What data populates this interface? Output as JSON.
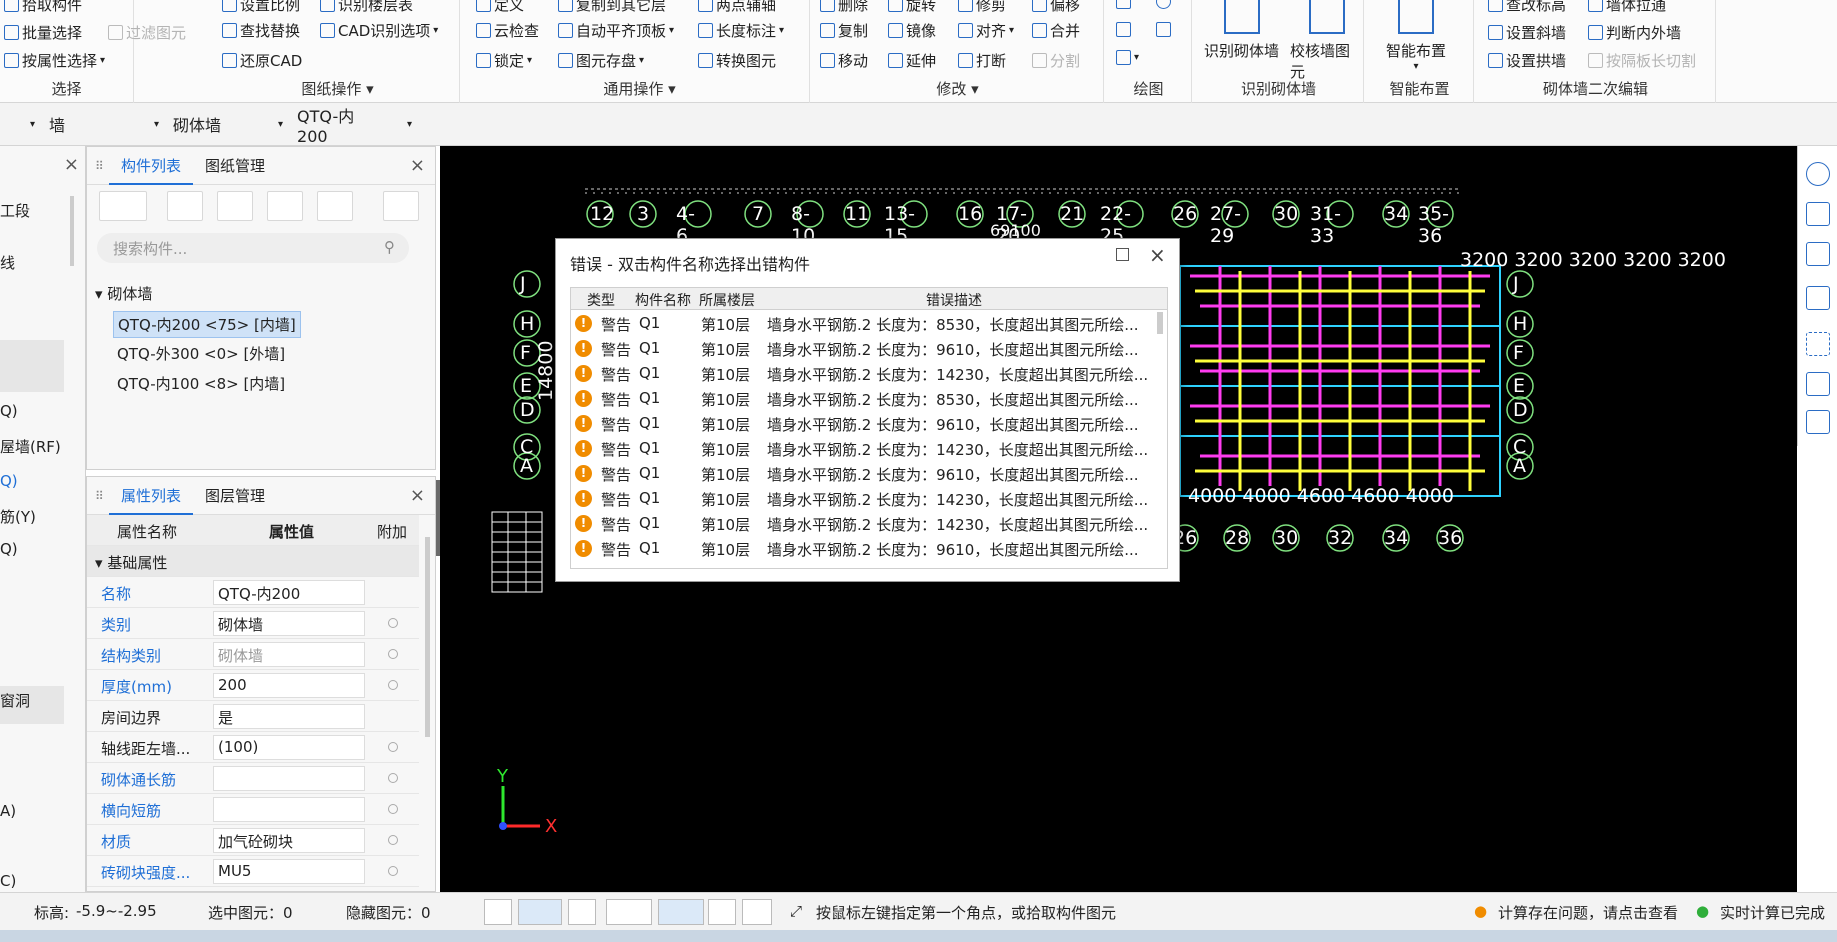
{
  "ribbon": {
    "select_group": {
      "items": [
        "拾取构件",
        "批量选择",
        "过滤图元",
        "按属性选择"
      ],
      "label": "选择"
    },
    "drawing_group": {
      "items": [
        "设置比例",
        "识别楼层表",
        "查找替换",
        "CAD识别选项",
        "还原CAD"
      ],
      "label": "图纸操作"
    },
    "general_group": {
      "items": [
        "定义",
        "复制到其它层",
        "两点辅轴",
        "云检查",
        "自动平齐顶板",
        "长度标注",
        "锁定",
        "图元存盘",
        "转换图元"
      ],
      "label": "通用操作"
    },
    "modify_group": {
      "items": [
        "删除",
        "旋转",
        "修剪",
        "偏移",
        "复制",
        "镜像",
        "对齐",
        "合并",
        "移动",
        "延伸",
        "打断",
        "分割"
      ],
      "label": "修改"
    },
    "draw_group": {
      "label": "绘图"
    },
    "recognize_group": {
      "items": [
        "识别砌体墙",
        "校核墙图元"
      ],
      "label": "识别砌体墙"
    },
    "smart_group": {
      "items": [
        "智能布置"
      ],
      "label": "智能布置"
    },
    "secondary_group": {
      "items": [
        "查改标高",
        "墙体拉通",
        "设置斜墙",
        "判断内外墙",
        "设置拱墙",
        "按隔板长切割"
      ],
      "label": "砌体墙二次编辑"
    }
  },
  "filter": {
    "floor": "墙",
    "type": "砌体墙",
    "component": "QTQ-内200"
  },
  "left_nav": {
    "items": [
      "工段",
      "线",
      "Q)",
      "屋墙(RF)",
      "Q)",
      "筋(Y)",
      "Q)",
      "窗洞",
      "A)",
      "C)"
    ]
  },
  "component_panel": {
    "tabs": [
      "构件列表",
      "图纸管理"
    ],
    "search_placeholder": "搜索构件...",
    "tree_root": "砌体墙",
    "items": [
      "QTQ-内200 <75> [内墙]",
      "QTQ-外300 <0> [外墙]",
      "QTQ-内100 <8> [内墙]"
    ]
  },
  "property_panel": {
    "tabs": [
      "属性列表",
      "图层管理"
    ],
    "headers": [
      "属性名称",
      "属性值",
      "附加"
    ],
    "section": "基础属性",
    "rows": [
      {
        "name": "名称",
        "value": "QTQ-内200"
      },
      {
        "name": "类别",
        "value": "砌体墙"
      },
      {
        "name": "结构类别",
        "value": "砌体墙"
      },
      {
        "name": "厚度(mm)",
        "value": "200"
      },
      {
        "name": "房间边界",
        "value": "是"
      },
      {
        "name": "轴线距左墙...",
        "value": "(100)"
      },
      {
        "name": "砌体通长筋",
        "value": ""
      },
      {
        "name": "横向短筋",
        "value": ""
      },
      {
        "name": "材质",
        "value": "加气砼砌块"
      },
      {
        "name": "砖砌块强度...",
        "value": "MU5"
      }
    ]
  },
  "canvas": {
    "axis_top": [
      "12",
      "3",
      "4-6",
      "7",
      "8-10",
      "11",
      "13-15",
      "16",
      "17-20",
      "21",
      "22-25",
      "26",
      "27-29",
      "30",
      "31-33",
      "34",
      "35-36"
    ],
    "axis_bottom": [
      "26",
      "28",
      "30",
      "32",
      "34",
      "36"
    ],
    "axis_left": [
      "J",
      "H",
      "F",
      "E",
      "D",
      "C",
      "A"
    ],
    "dim_bottom": "4000 4000 4600 4600 4000",
    "dim_top_right": "3200 3200 3200 3200 3200",
    "dim_left": "14800",
    "dim_top": "69100",
    "ucs_x": "X",
    "ucs_y": "Y"
  },
  "dialog": {
    "title": "错误 - 双击构件名称选择出错构件",
    "headers": [
      "类型",
      "构件名称",
      "所属楼层",
      "错误描述"
    ],
    "rows": [
      {
        "type": "警告",
        "name": "Q1",
        "floor": "第10层",
        "desc": "墙身水平钢筋.2 长度为：8530，长度超出其图元所绘..."
      },
      {
        "type": "警告",
        "name": "Q1",
        "floor": "第10层",
        "desc": "墙身水平钢筋.2 长度为：9610，长度超出其图元所绘..."
      },
      {
        "type": "警告",
        "name": "Q1",
        "floor": "第10层",
        "desc": "墙身水平钢筋.2 长度为：14230，长度超出其图元所绘..."
      },
      {
        "type": "警告",
        "name": "Q1",
        "floor": "第10层",
        "desc": "墙身水平钢筋.2 长度为：8530，长度超出其图元所绘..."
      },
      {
        "type": "警告",
        "name": "Q1",
        "floor": "第10层",
        "desc": "墙身水平钢筋.2 长度为：9610，长度超出其图元所绘..."
      },
      {
        "type": "警告",
        "name": "Q1",
        "floor": "第10层",
        "desc": "墙身水平钢筋.2 长度为：14230，长度超出其图元所绘..."
      },
      {
        "type": "警告",
        "name": "Q1",
        "floor": "第10层",
        "desc": "墙身水平钢筋.2 长度为：9610，长度超出其图元所绘..."
      },
      {
        "type": "警告",
        "name": "Q1",
        "floor": "第10层",
        "desc": "墙身水平钢筋.2 长度为：14230，长度超出其图元所绘..."
      },
      {
        "type": "警告",
        "name": "Q1",
        "floor": "第10层",
        "desc": "墙身水平钢筋.2 长度为：14230，长度超出其图元所绘..."
      },
      {
        "type": "警告",
        "name": "Q1",
        "floor": "第10层",
        "desc": "墙身水平钢筋.2 长度为：9610，长度超出其图元所绘..."
      }
    ]
  },
  "status": {
    "elevation_label": "标高:",
    "elevation": "-5.9~-2.95",
    "selected": "选中图元：0",
    "hidden": "隐藏图元：0",
    "hint": "按鼠标左键指定第一个角点，或拾取构件图元",
    "warning": "计算存在问题，请点击查看",
    "ok": "实时计算已完成"
  },
  "colors": {
    "accent": "#1f6fd6",
    "warning": "#f08c00",
    "canvas": "#000000",
    "ok": "#2fae3a"
  }
}
